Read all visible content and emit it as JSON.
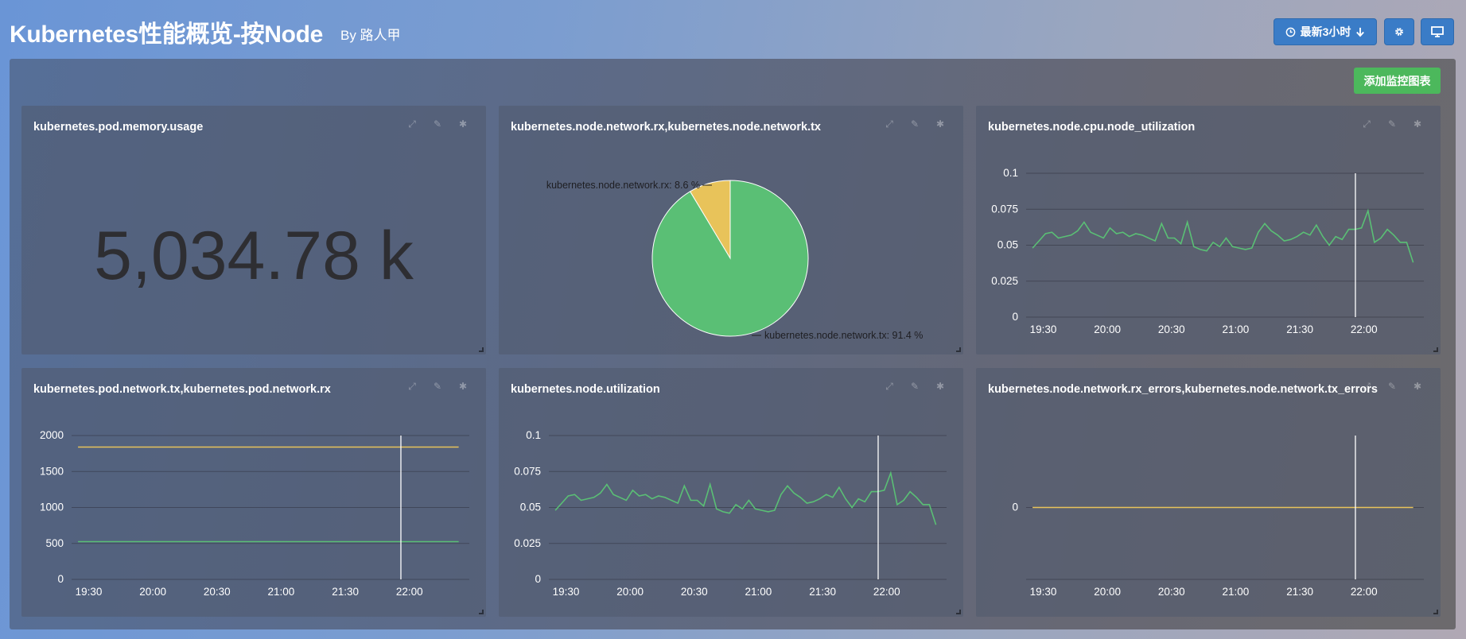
{
  "header": {
    "title": "Kubernetes性能概览-按Node",
    "byline": "By  路人甲",
    "time_button": "最新3小时"
  },
  "toolbar": {
    "add_chart": "添加监控图表"
  },
  "icons": {
    "clock": "clock-icon",
    "arrow_down": "arrow-down-icon",
    "gear": "gear-icon",
    "monitor": "monitor-icon",
    "expand": "expand-icon",
    "edit": "edit-icon"
  },
  "colors": {
    "green": "#5abf75",
    "yellow": "#e8c35a",
    "add_button": "#4cb85c",
    "primary_button": "#3a7cc7"
  },
  "panels": [
    {
      "title": "kubernetes.pod.memory.usage",
      "value": "5,034.78 k"
    },
    {
      "title": "kubernetes.node.network.rx,kubernetes.node.network.tx"
    },
    {
      "title": "kubernetes.node.cpu.node_utilization"
    },
    {
      "title": "kubernetes.pod.network.tx,kubernetes.pod.network.rx"
    },
    {
      "title": "kubernetes.node.utilization"
    },
    {
      "title": "kubernetes.node.network.rx_errors,kubernetes.node.network.tx_errors"
    }
  ],
  "chart_data": [
    {
      "panel": 1,
      "type": "pie",
      "slices": [
        {
          "label": "kubernetes.node.network.rx: 8.6 %",
          "value": 8.6,
          "color": "#e8c35a"
        },
        {
          "label": "kubernetes.node.network.tx: 91.4 %",
          "value": 91.4,
          "color": "#5abf75"
        }
      ]
    },
    {
      "panel": 2,
      "type": "line",
      "x_ticks": [
        "19:30",
        "20:00",
        "20:30",
        "21:00",
        "21:30",
        "22:00"
      ],
      "y_ticks": [
        "0",
        "0.025",
        "0.05",
        "0.075",
        "0.1"
      ],
      "ylim": [
        0,
        0.1
      ],
      "marker_time": "21:56",
      "series": [
        {
          "color": "#5abf75",
          "values": [
            0.048,
            0.053,
            0.058,
            0.059,
            0.055,
            0.056,
            0.057,
            0.06,
            0.066,
            0.059,
            0.057,
            0.055,
            0.062,
            0.058,
            0.059,
            0.056,
            0.058,
            0.057,
            0.055,
            0.053,
            0.065,
            0.055,
            0.055,
            0.051,
            0.066,
            0.049,
            0.047,
            0.046,
            0.052,
            0.049,
            0.055,
            0.049,
            0.048,
            0.047,
            0.048,
            0.059,
            0.065,
            0.06,
            0.057,
            0.053,
            0.054,
            0.056,
            0.059,
            0.057,
            0.064,
            0.056,
            0.05,
            0.056,
            0.054,
            0.061,
            0.061,
            0.062,
            0.074,
            0.052,
            0.055,
            0.061,
            0.057,
            0.052,
            0.052,
            0.038
          ]
        }
      ]
    },
    {
      "panel": 3,
      "type": "line",
      "x_ticks": [
        "19:30",
        "20:00",
        "20:30",
        "21:00",
        "21:30",
        "22:00"
      ],
      "y_ticks": [
        "0",
        "500",
        "1000",
        "1500",
        "2000"
      ],
      "ylim": [
        0,
        2000
      ],
      "marker_time": "21:56",
      "series": [
        {
          "color": "#e8c35a",
          "values": [
            1840,
            1840
          ]
        },
        {
          "color": "#5abf75",
          "values": [
            525,
            525
          ]
        }
      ]
    },
    {
      "panel": 4,
      "type": "line",
      "x_ticks": [
        "19:30",
        "20:00",
        "20:30",
        "21:00",
        "21:30",
        "22:00"
      ],
      "y_ticks": [
        "0",
        "0.025",
        "0.05",
        "0.075",
        "0.1"
      ],
      "ylim": [
        0,
        0.1
      ],
      "marker_time": "21:56",
      "series": [
        {
          "color": "#5abf75",
          "values": [
            0.048,
            0.053,
            0.058,
            0.059,
            0.055,
            0.056,
            0.057,
            0.06,
            0.066,
            0.059,
            0.057,
            0.055,
            0.062,
            0.058,
            0.059,
            0.056,
            0.058,
            0.057,
            0.055,
            0.053,
            0.065,
            0.055,
            0.055,
            0.051,
            0.066,
            0.049,
            0.047,
            0.046,
            0.052,
            0.049,
            0.055,
            0.049,
            0.048,
            0.047,
            0.048,
            0.059,
            0.065,
            0.06,
            0.057,
            0.053,
            0.054,
            0.056,
            0.059,
            0.057,
            0.064,
            0.056,
            0.05,
            0.056,
            0.054,
            0.061,
            0.061,
            0.062,
            0.074,
            0.052,
            0.055,
            0.061,
            0.057,
            0.052,
            0.052,
            0.038
          ]
        }
      ]
    },
    {
      "panel": 5,
      "type": "line",
      "x_ticks": [
        "19:30",
        "20:00",
        "20:30",
        "21:00",
        "21:30",
        "22:00"
      ],
      "y_ticks": [
        "0"
      ],
      "ylim": [
        -1,
        1
      ],
      "marker_time": "21:56",
      "series": [
        {
          "color": "#e8c35a",
          "values": [
            0,
            0
          ]
        }
      ]
    }
  ]
}
